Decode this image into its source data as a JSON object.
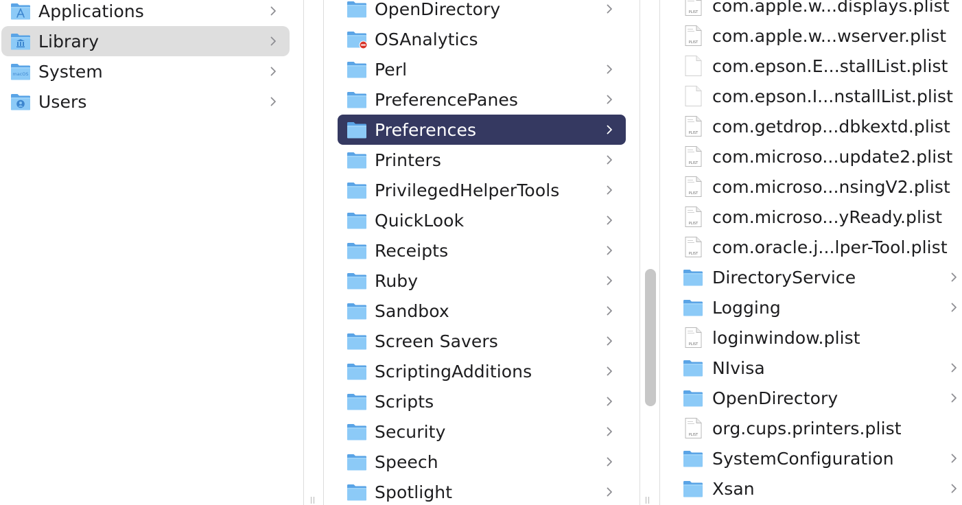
{
  "col1": {
    "items": [
      {
        "label": "Applications",
        "icon": "applications-folder-icon",
        "chevron": true
      },
      {
        "label": "Library",
        "icon": "library-folder-icon",
        "chevron": true,
        "selected": true
      },
      {
        "label": "System",
        "icon": "macos-folder-icon",
        "chevron": true
      },
      {
        "label": "Users",
        "icon": "users-folder-icon",
        "chevron": true
      }
    ]
  },
  "col2": {
    "items": [
      {
        "label": "OpenDirectory",
        "icon": "folder-icon",
        "chevron": true
      },
      {
        "label": "OSAnalytics",
        "icon": "restricted-folder-icon",
        "chevron": false
      },
      {
        "label": "Perl",
        "icon": "folder-icon",
        "chevron": true
      },
      {
        "label": "PreferencePanes",
        "icon": "folder-icon",
        "chevron": true
      },
      {
        "label": "Preferences",
        "icon": "folder-icon",
        "chevron": true,
        "selected": true
      },
      {
        "label": "Printers",
        "icon": "folder-icon",
        "chevron": true
      },
      {
        "label": "PrivilegedHelperTools",
        "icon": "folder-icon",
        "chevron": true
      },
      {
        "label": "QuickLook",
        "icon": "folder-icon",
        "chevron": true
      },
      {
        "label": "Receipts",
        "icon": "folder-icon",
        "chevron": true
      },
      {
        "label": "Ruby",
        "icon": "folder-icon",
        "chevron": true
      },
      {
        "label": "Sandbox",
        "icon": "folder-icon",
        "chevron": true
      },
      {
        "label": "Screen Savers",
        "icon": "folder-icon",
        "chevron": true
      },
      {
        "label": "ScriptingAdditions",
        "icon": "folder-icon",
        "chevron": true
      },
      {
        "label": "Scripts",
        "icon": "folder-icon",
        "chevron": true
      },
      {
        "label": "Security",
        "icon": "folder-icon",
        "chevron": true
      },
      {
        "label": "Speech",
        "icon": "folder-icon",
        "chevron": true
      },
      {
        "label": "Spotlight",
        "icon": "folder-icon",
        "chevron": true
      }
    ]
  },
  "col3": {
    "items": [
      {
        "label": "com.apple.w...displays.plist",
        "icon": "plist-file-icon",
        "chevron": false
      },
      {
        "label": "com.apple.w...wserver.plist",
        "icon": "plist-file-icon",
        "chevron": false
      },
      {
        "label": "com.epson.E...stallList.plist",
        "icon": "blank-file-icon",
        "chevron": false
      },
      {
        "label": "com.epson.I...nstallList.plist",
        "icon": "blank-file-icon",
        "chevron": false
      },
      {
        "label": "com.getdrop...dbkextd.plist",
        "icon": "plist-file-icon",
        "chevron": false
      },
      {
        "label": "com.microso...update2.plist",
        "icon": "plist-file-icon",
        "chevron": false
      },
      {
        "label": "com.microso...nsingV2.plist",
        "icon": "plist-file-icon",
        "chevron": false
      },
      {
        "label": "com.microso...yReady.plist",
        "icon": "plist-file-icon",
        "chevron": false
      },
      {
        "label": "com.oracle.j...lper-Tool.plist",
        "icon": "plist-file-icon",
        "chevron": false
      },
      {
        "label": "DirectoryService",
        "icon": "folder-icon",
        "chevron": true
      },
      {
        "label": "Logging",
        "icon": "folder-icon",
        "chevron": true
      },
      {
        "label": "loginwindow.plist",
        "icon": "plist-file-icon",
        "chevron": false
      },
      {
        "label": "NIvisa",
        "icon": "folder-icon",
        "chevron": true
      },
      {
        "label": "OpenDirectory",
        "icon": "folder-icon",
        "chevron": true
      },
      {
        "label": "org.cups.printers.plist",
        "icon": "plist-file-icon",
        "chevron": false
      },
      {
        "label": "SystemConfiguration",
        "icon": "folder-icon",
        "chevron": true
      },
      {
        "label": "Xsan",
        "icon": "folder-icon",
        "chevron": true
      }
    ]
  },
  "plist_tag": "PLIST",
  "macos_tag": "macOS",
  "colors": {
    "folder_back": "#5aa4e6",
    "folder_front": "#8ccaf7",
    "selection_active": "#353961",
    "selection_inactive": "#dedede"
  }
}
